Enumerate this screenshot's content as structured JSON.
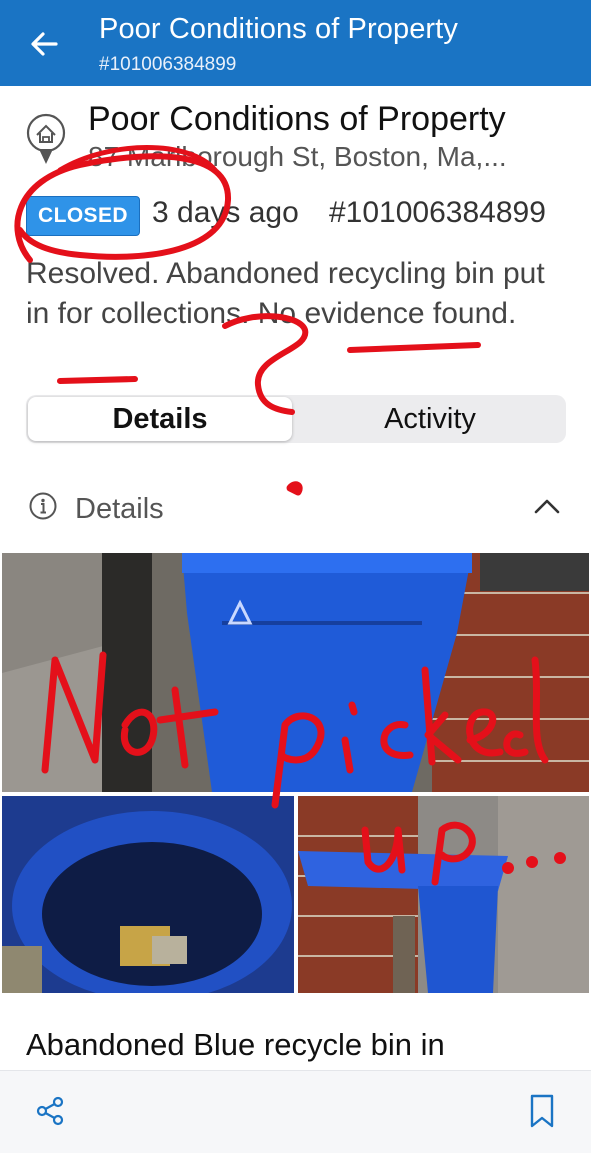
{
  "app_bar": {
    "title": "Poor Conditions of Property",
    "case_number": "#101006384899"
  },
  "report": {
    "title": "Poor Conditions of Property",
    "address": "87 Marlborough St, Boston, Ma,...",
    "status": "CLOSED",
    "age": "3 days ago",
    "case_number": "#101006384899",
    "resolution": "Resolved. Abandoned recycling bin put in for collections. No evidence found."
  },
  "tabs": {
    "details": "Details",
    "activity": "Activity",
    "selected": "Details"
  },
  "details_section": {
    "label": "Details",
    "expanded": true
  },
  "photos": [
    {
      "name": "Blue recycle bin beside brick wall"
    },
    {
      "name": "Inside of blue recycle bin"
    },
    {
      "name": "Blue recycle bin in alley"
    }
  ],
  "description": "Abandoned Blue recycle bin in",
  "annotations": {
    "color": "#e4101a",
    "handwritten_text": "Not picked up..."
  },
  "colors": {
    "app_bar": "#1a74c4",
    "badge": "#2f93e8"
  },
  "icons": [
    "back-arrow-icon",
    "location-pin-icon",
    "info-icon",
    "chevron-up-icon",
    "share-icon",
    "bookmark-icon",
    "recycle-icon"
  ]
}
